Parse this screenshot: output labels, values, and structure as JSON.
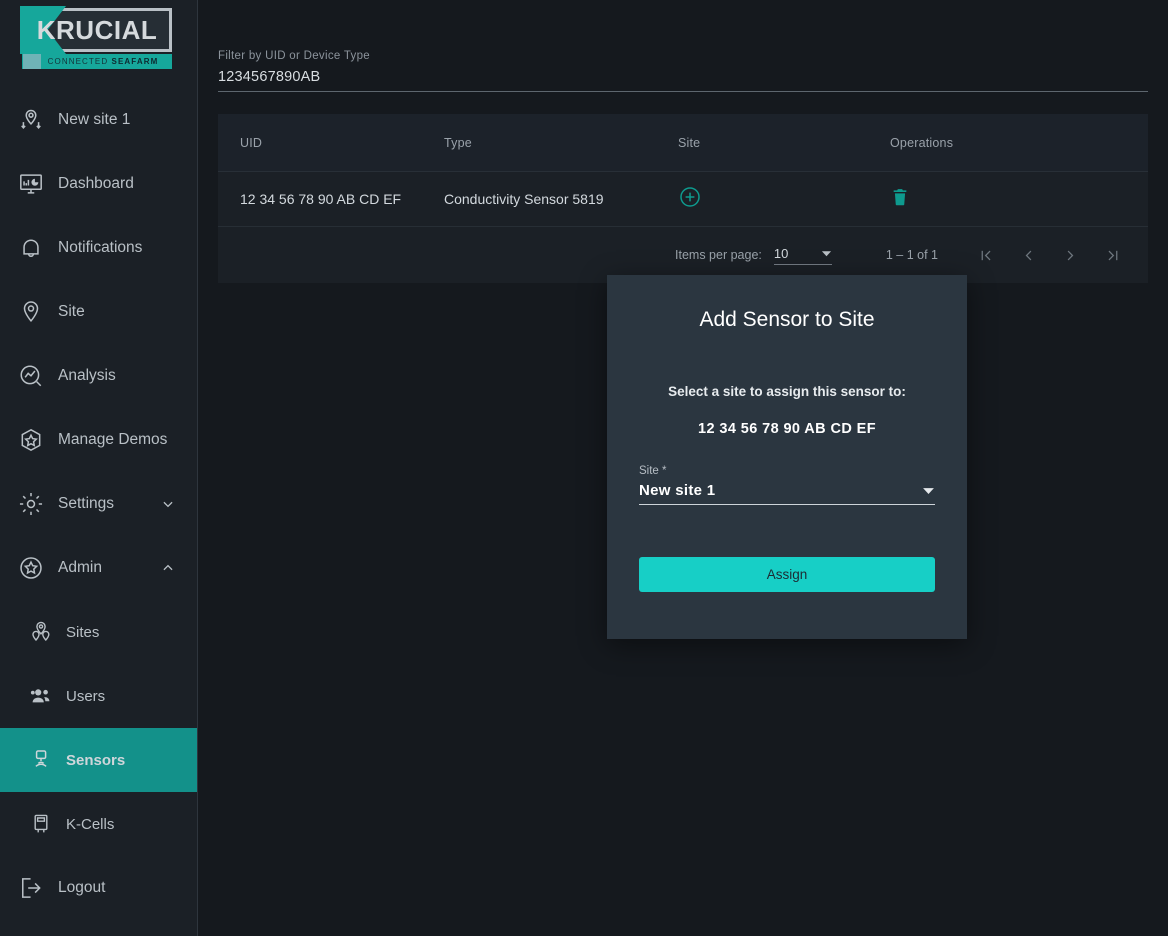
{
  "brand": {
    "name": "KRUCIAL",
    "tagline_light": "CONNECTED ",
    "tagline_bold": "SEAFARM"
  },
  "colors": {
    "accent_teal": "#17cfc6",
    "active_nav": "#13918a",
    "page_bg": "#15191e",
    "sidebar_bg": "#1b2026",
    "modal_bg": "#2b3640",
    "table_header_bg": "#1c222a"
  },
  "sidebar": {
    "items": [
      {
        "label": "New site 1",
        "icon": "site-transfer-icon",
        "level": "top",
        "active": false,
        "chevron": null
      },
      {
        "label": "Dashboard",
        "icon": "dashboard-icon",
        "level": "top",
        "active": false,
        "chevron": null
      },
      {
        "label": "Notifications",
        "icon": "bell-icon",
        "level": "top",
        "active": false,
        "chevron": null
      },
      {
        "label": "Site",
        "icon": "map-pin-icon",
        "level": "top",
        "active": false,
        "chevron": null
      },
      {
        "label": "Analysis",
        "icon": "analysis-icon",
        "level": "top",
        "active": false,
        "chevron": null
      },
      {
        "label": "Manage Demos",
        "icon": "hexagon-star-icon",
        "level": "top",
        "active": false,
        "chevron": null
      },
      {
        "label": "Settings",
        "icon": "gear-icon",
        "level": "top",
        "active": false,
        "chevron": "down"
      },
      {
        "label": "Admin",
        "icon": "circle-star-icon",
        "level": "top",
        "active": false,
        "chevron": "up"
      },
      {
        "label": "Sites",
        "icon": "multi-pin-icon",
        "level": "sub",
        "active": false,
        "chevron": null
      },
      {
        "label": "Users",
        "icon": "users-icon",
        "level": "sub",
        "active": false,
        "chevron": null
      },
      {
        "label": "Sensors",
        "icon": "sensor-icon",
        "level": "sub",
        "active": true,
        "chevron": null
      },
      {
        "label": "K-Cells",
        "icon": "kcell-icon",
        "level": "sub",
        "active": false,
        "chevron": null
      },
      {
        "label": "Logout",
        "icon": "logout-icon",
        "level": "top",
        "active": false,
        "chevron": null
      }
    ]
  },
  "filter": {
    "label": "Filter by UID or Device Type",
    "value": "1234567890AB",
    "placeholder": "Filter by UID or Device Type"
  },
  "table": {
    "columns": [
      "UID",
      "Type",
      "Site",
      "Operations"
    ],
    "rows": [
      {
        "uid": "12 34 56 78 90 AB CD EF",
        "type": "Conductivity Sensor 5819",
        "site_action": "add-to-site",
        "operation_action": "delete"
      }
    ]
  },
  "paginator": {
    "items_per_page_label": "Items per page:",
    "items_per_page_value": "10",
    "range_label": "1 – 1 of 1",
    "first_page": "first-page",
    "prev_page": "previous-page",
    "next_page": "next-page",
    "last_page": "last-page"
  },
  "modal": {
    "title": "Add Sensor to Site",
    "subtitle": "Select a site to assign this sensor to:",
    "uid": "12 34 56 78 90 AB CD EF",
    "select_label": "Site *",
    "select_value": "New site 1",
    "assign_label": "Assign"
  }
}
